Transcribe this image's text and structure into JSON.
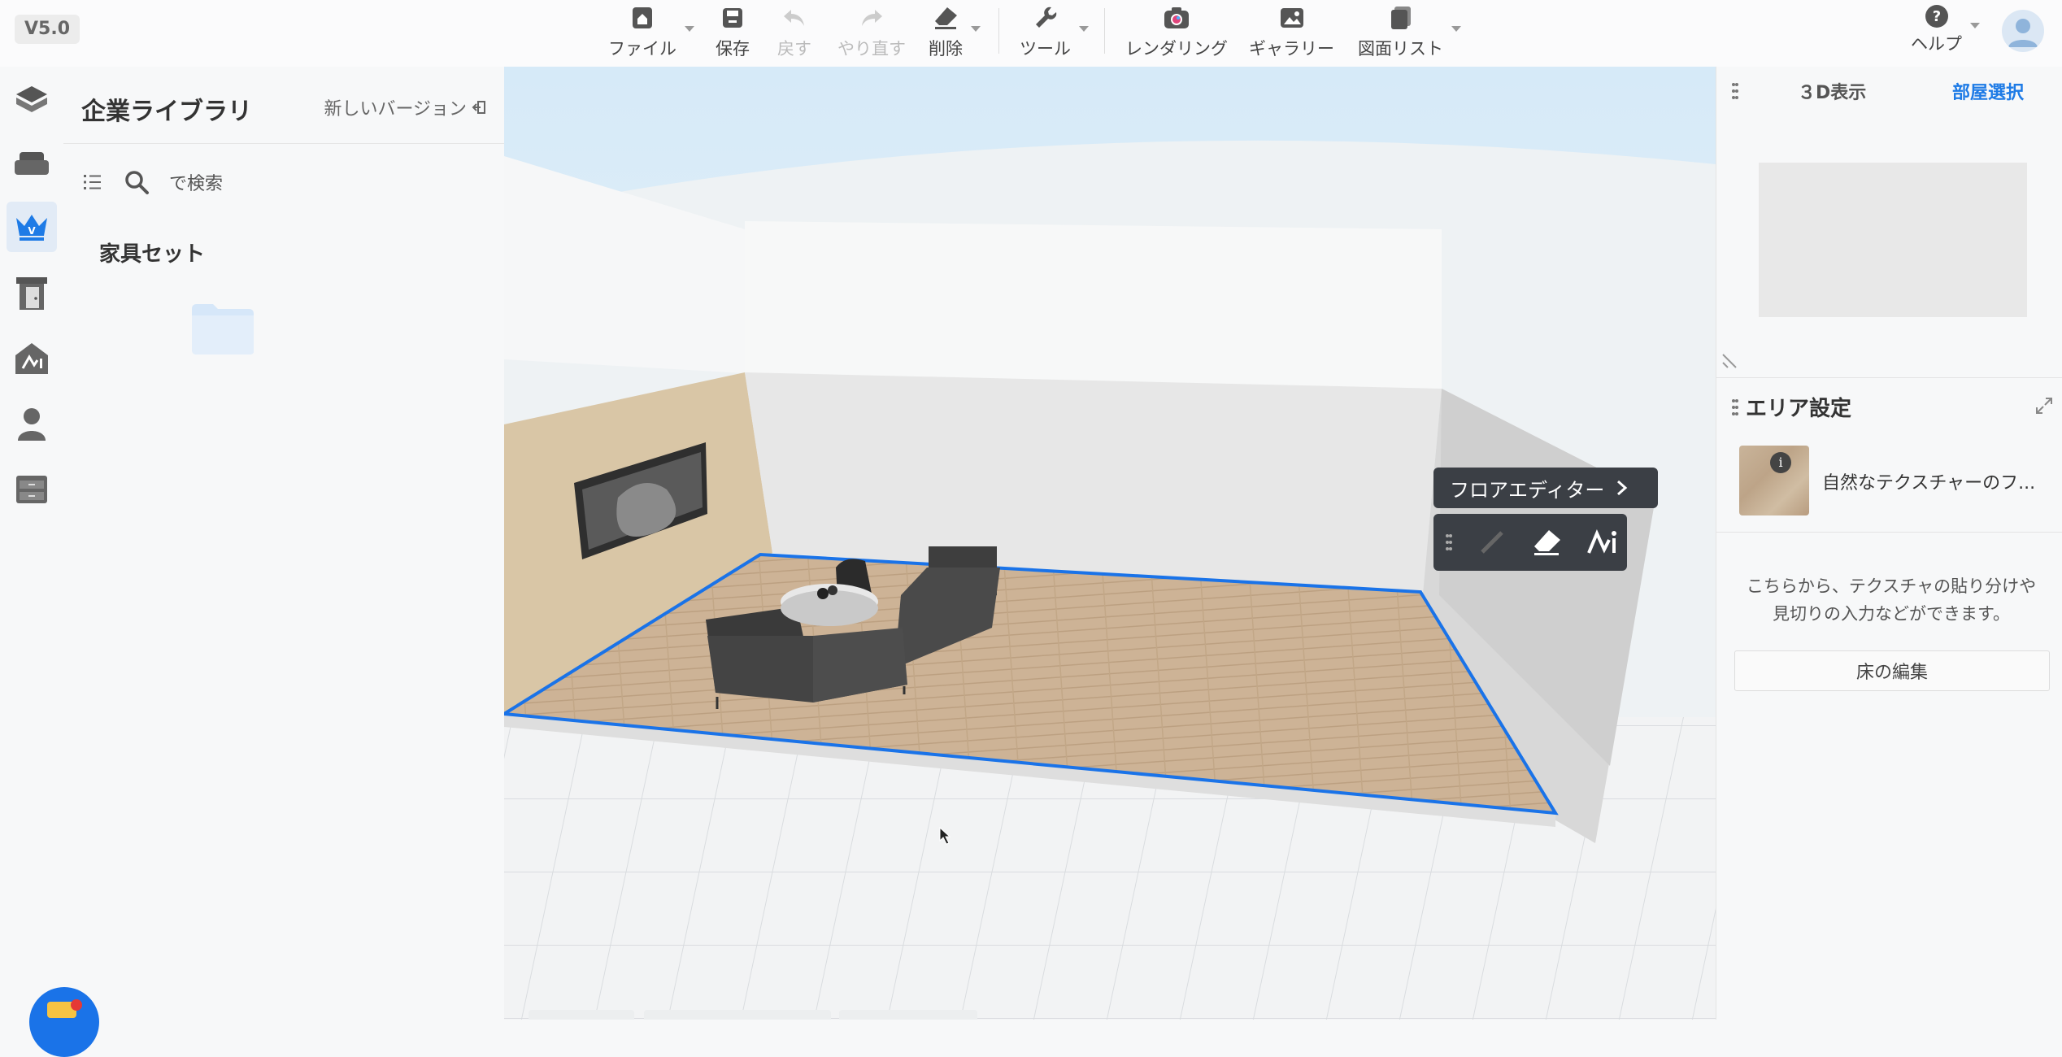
{
  "version": "V5.0",
  "toolbar": {
    "file": "ファイル",
    "save": "保存",
    "undo": "戻す",
    "redo": "やり直す",
    "delete": "削除",
    "tools": "ツール",
    "rendering": "レンダリング",
    "gallery": "ギャラリー",
    "drawing_list": "図面リスト",
    "help": "ヘルプ"
  },
  "library": {
    "title": "企業ライブラリ",
    "new_version": "新しいバージョン",
    "search_placeholder": "で検索",
    "section": "家具セット"
  },
  "viewport": {
    "floor_editor": "フロアエディター"
  },
  "right_panel": {
    "view_3d": "３D表示",
    "room_select": "部屋選択",
    "area_settings": "エリア設定",
    "texture_name": "自然なテクスチャーのフ...",
    "help_text_line1": "こちらから、テクスチャの貼り分けや",
    "help_text_line2": "見切りの入力などができます。",
    "floor_edit": "床の編集"
  },
  "colors": {
    "accent": "#1e7be6",
    "selection_outline": "#1a73e8",
    "floating_toolbar": "#3b3f45"
  }
}
